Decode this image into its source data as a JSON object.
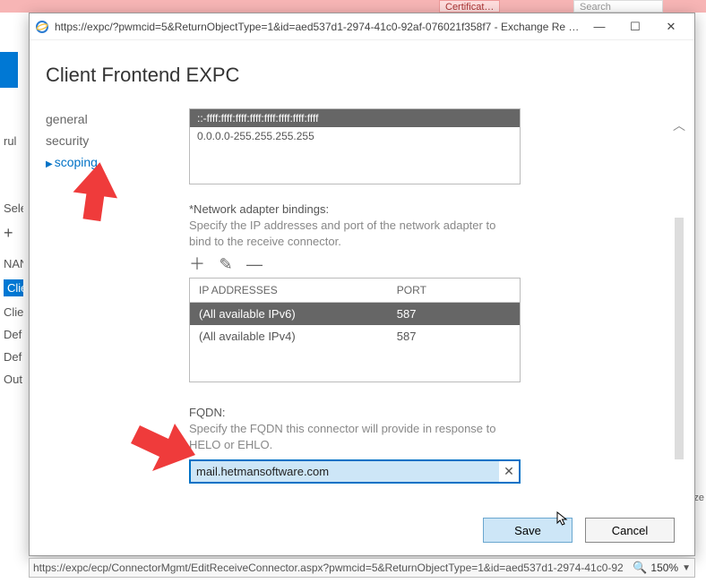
{
  "bg": {
    "cert": "Certificat…",
    "search": "Search",
    "rul": "rul",
    "sele": "Sele",
    "plus": "+",
    "nan": "NAN",
    "rows": [
      "Clie",
      "Clie",
      "Def",
      "Def",
      "Out"
    ],
    "right_char": "ze"
  },
  "window": {
    "url": "https://expc/?pwmcid=5&ReturnObjectType=1&id=aed537d1-2974-41c0-92af-076021f358f7 - Exchange Re - ...",
    "min": "—",
    "max": "☐",
    "close": "✕"
  },
  "page": {
    "title": "Client Frontend EXPC"
  },
  "sidenav": {
    "items": [
      {
        "label": "general"
      },
      {
        "label": "security"
      },
      {
        "label": "scoping"
      }
    ]
  },
  "remote_ranges": {
    "row_selected": "::-ffff:ffff:ffff:ffff:ffff:ffff:ffff:ffff",
    "row2": "0.0.0.0-255.255.255.255"
  },
  "bindings": {
    "label": "*Network adapter bindings:",
    "help": "Specify the IP addresses and port of the network adapter to bind to the receive connector.",
    "toolbar": {
      "add": "＋",
      "edit": "✎",
      "remove": "—"
    },
    "columns": {
      "ip": "IP ADDRESSES",
      "port": "PORT"
    },
    "rows": [
      {
        "ip": "(All available IPv6)",
        "port": "587"
      },
      {
        "ip": "(All available IPv4)",
        "port": "587"
      }
    ]
  },
  "fqdn": {
    "label": "FQDN:",
    "help": "Specify the FQDN this connector will provide in response to HELO or EHLO.",
    "value": "mail.hetmansoftware.com",
    "clear": "✕"
  },
  "buttons": {
    "save": "Save",
    "cancel": "Cancel"
  },
  "statusbar": {
    "url": "https://expc/ecp/ConnectorMgmt/EditReceiveConnector.aspx?pwmcid=5&ReturnObjectType=1&id=aed537d1-2974-41c0-92",
    "zoom": "150%"
  }
}
